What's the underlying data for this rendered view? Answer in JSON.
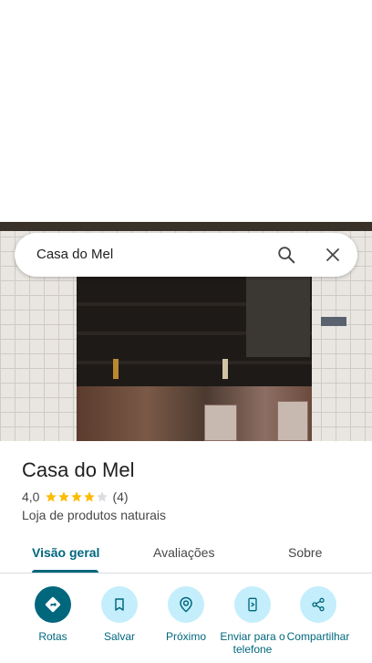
{
  "search": {
    "query": "Casa do Mel"
  },
  "place": {
    "name": "Casa do Mel",
    "rating": "4,0",
    "rating_value": 4,
    "rating_max": 5,
    "review_count": "(4)",
    "category": "Loja de produtos naturais"
  },
  "tabs": [
    {
      "label": "Visão geral",
      "active": true
    },
    {
      "label": "Avaliações",
      "active": false
    },
    {
      "label": "Sobre",
      "active": false
    }
  ],
  "actions": [
    {
      "label": "Rotas",
      "icon": "directions-icon"
    },
    {
      "label": "Salvar",
      "icon": "bookmark-icon"
    },
    {
      "label": "Próximo",
      "icon": "nearby-icon"
    },
    {
      "label": "Enviar para o telefone",
      "icon": "send-to-phone-icon"
    },
    {
      "label": "Compartilhar",
      "icon": "share-icon"
    }
  ],
  "colors": {
    "accent": "#00677d",
    "action_bg": "#c4eefb",
    "star": "#fbbc04",
    "star_empty": "#dadce0"
  }
}
